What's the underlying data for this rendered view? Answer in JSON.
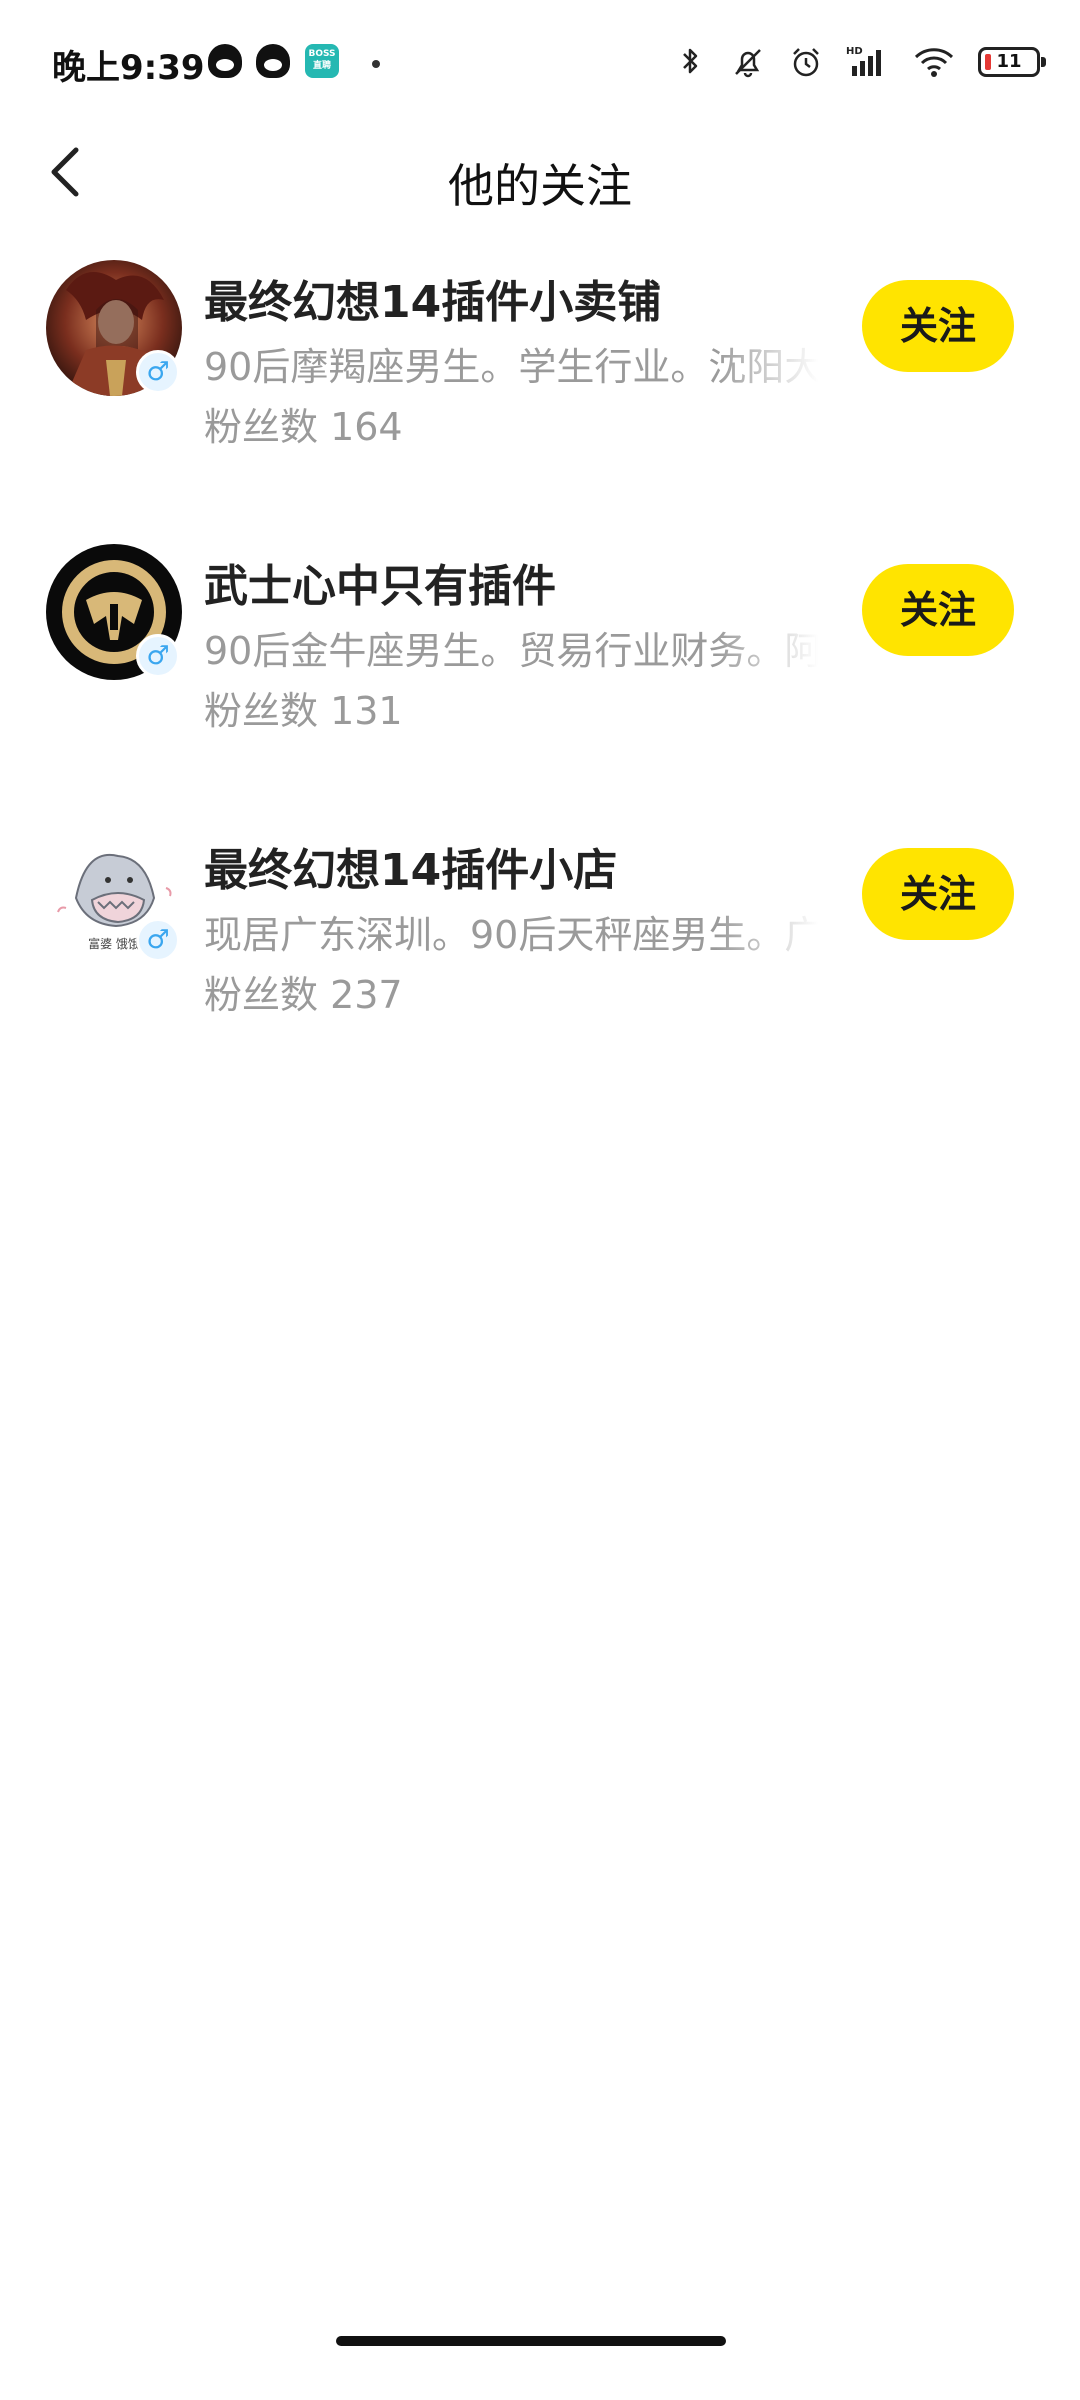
{
  "status_bar": {
    "time": "晚上9:39",
    "apps": [
      "qq-icon",
      "qq-icon",
      "boss-app-icon"
    ],
    "boss_label": "BOSS\n直聘",
    "battery_level": "11",
    "icons": [
      "bluetooth-icon",
      "mute-bell-icon",
      "alarm-icon",
      "signal-hd-icon",
      "wifi-icon",
      "battery-icon"
    ]
  },
  "header": {
    "title": "他的关注",
    "back_icon": "chevron-left-icon"
  },
  "follow_list": [
    {
      "name": "最终幻想14插件小卖铺",
      "description": "90后摩羯座男生。学生行业。沈阳大",
      "fans": "粉丝数 164",
      "gender_symbol": "♂",
      "button_label": "关注",
      "avatar_icon": "character-portrait-avatar"
    },
    {
      "name": "武士心中只有插件",
      "description": "90后金牛座男生。贸易行业财务。阿",
      "fans": "粉丝数 131",
      "gender_symbol": "♂",
      "button_label": "关注",
      "avatar_icon": "gold-emblem-avatar"
    },
    {
      "name": "最终幻想14插件小店",
      "description": "现居广东深圳。90后天秤座男生。广",
      "fans": "粉丝数 237",
      "gender_symbol": "♂",
      "button_label": "关注",
      "avatar_icon": "shark-cartoon-avatar",
      "avatar_caption": "富婆 饿饿"
    }
  ],
  "colors": {
    "follow_button": "#ffe400",
    "gender_badge_bg": "#e6f4ff",
    "gender_symbol": "#3aa6ef",
    "secondary_text": "#9a9a9a",
    "primary_text": "#222222"
  }
}
